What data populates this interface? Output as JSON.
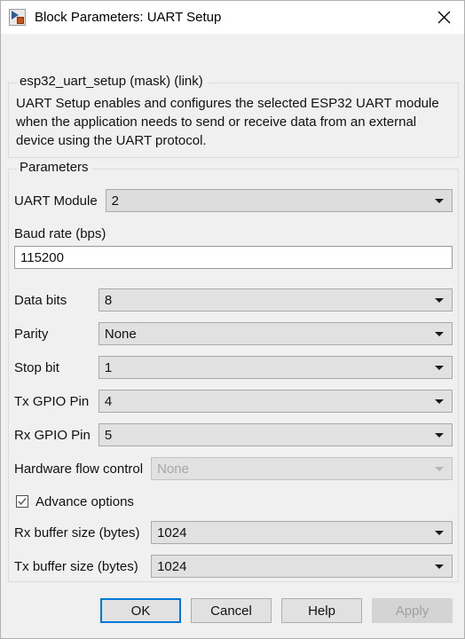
{
  "window": {
    "title": "Block Parameters: UART Setup",
    "icon": "simulink-block-icon",
    "close_icon": "close-icon"
  },
  "description": {
    "legend": "esp32_uart_setup (mask) (link)",
    "text": "UART Setup enables and configures the selected ESP32 UART module when the application needs to send or receive data from an external device using the UART protocol."
  },
  "parameters": {
    "legend": "Parameters",
    "uart_module": {
      "label": "UART Module",
      "value": "2"
    },
    "baud_rate": {
      "label": "Baud rate (bps)",
      "value": "115200"
    },
    "data_bits": {
      "label": "Data bits",
      "value": "8"
    },
    "parity": {
      "label": "Parity",
      "value": "None"
    },
    "stop_bit": {
      "label": "Stop bit",
      "value": "1"
    },
    "tx_gpio_pin": {
      "label": "Tx GPIO Pin",
      "value": "4"
    },
    "rx_gpio_pin": {
      "label": "Rx GPIO Pin",
      "value": "5"
    },
    "hardware_flow_control": {
      "label": "Hardware flow control",
      "value": "None"
    },
    "advance_options": {
      "label": "Advance options",
      "checked": "✓"
    },
    "rx_buffer_size": {
      "label": "Rx buffer size (bytes)",
      "value": "1024"
    },
    "tx_buffer_size": {
      "label": "Tx buffer size (bytes)",
      "value": "1024"
    }
  },
  "footer": {
    "ok": "OK",
    "cancel": "Cancel",
    "help": "Help",
    "apply": "Apply"
  },
  "colors": {
    "focus_border": "#0078d7",
    "dialog_bg": "#f0f0f0",
    "field_bg": "#e1e1e1"
  }
}
